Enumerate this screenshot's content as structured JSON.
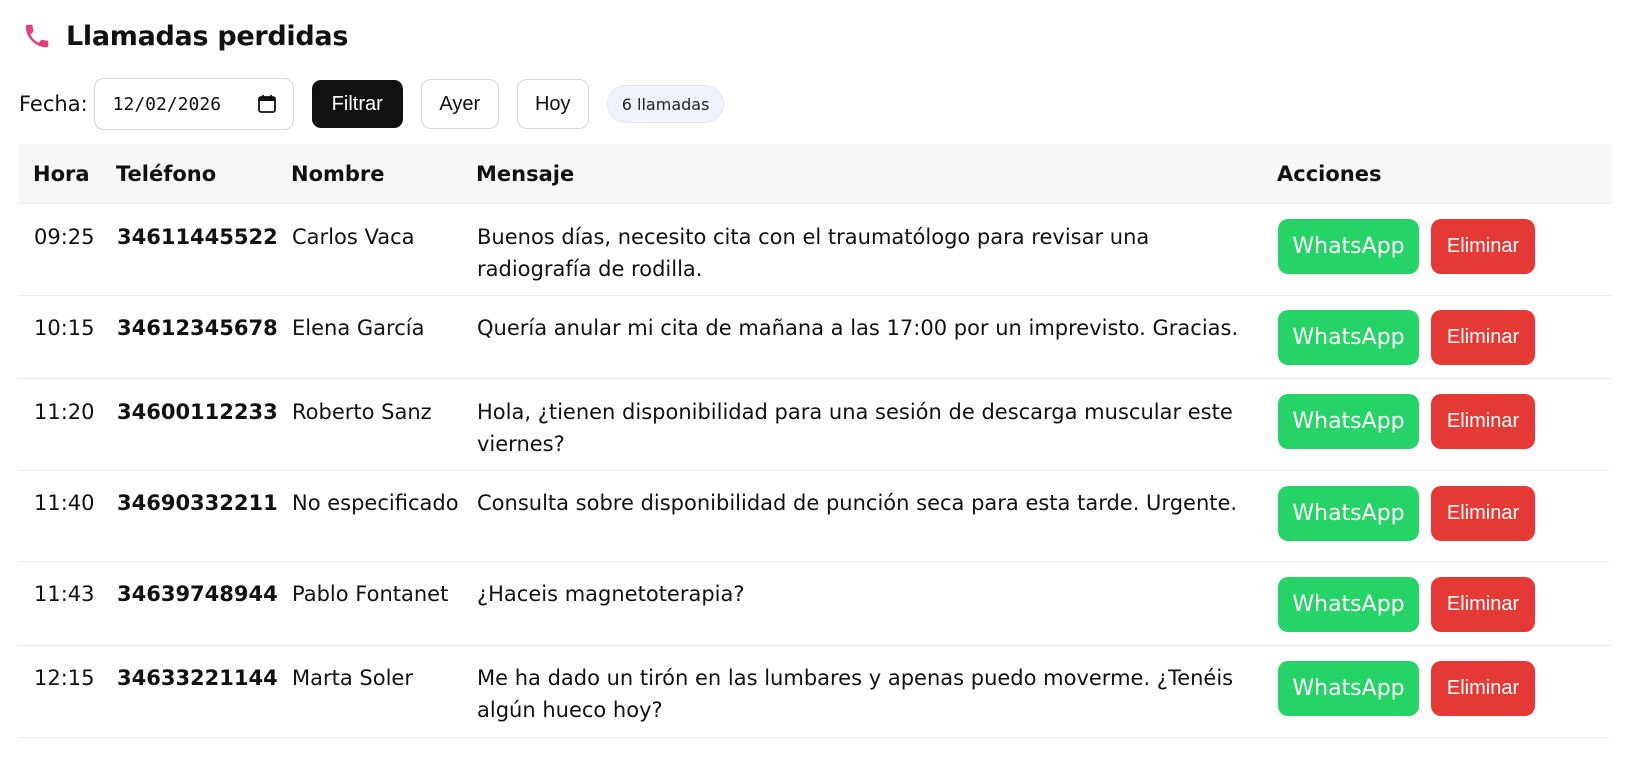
{
  "header": {
    "title": "Llamadas perdidas",
    "icon": "phone-icon",
    "icon_color": "#e0407a"
  },
  "toolbar": {
    "fecha_label": "Fecha:",
    "date_value": "12/02/2026",
    "filter_label": "Filtrar",
    "yesterday_label": "Ayer",
    "today_label": "Hoy",
    "count_badge": "6 llamadas"
  },
  "table": {
    "headers": {
      "hora": "Hora",
      "telefono": "Teléfono",
      "nombre": "Nombre",
      "mensaje": "Mensaje",
      "acciones": "Acciones"
    },
    "rows": [
      {
        "hora": "09:25",
        "telefono": "34611445522",
        "nombre": "Carlos Vaca",
        "mensaje": "Buenos días, necesito cita con el traumatólogo para revisar una radiografía de rodilla."
      },
      {
        "hora": "10:15",
        "telefono": "34612345678",
        "nombre": "Elena García",
        "mensaje": "Quería anular mi cita de mañana a las 17:00 por un imprevisto. Gracias."
      },
      {
        "hora": "11:20",
        "telefono": "34600112233",
        "nombre": "Roberto Sanz",
        "mensaje": "Hola, ¿tienen disponibilidad para una sesión de descarga muscular este viernes?"
      },
      {
        "hora": "11:40",
        "telefono": "34690332211",
        "nombre": "No especificado",
        "mensaje": "Consulta sobre disponibilidad de punción seca para esta tarde. Urgente."
      },
      {
        "hora": "11:43",
        "telefono": "34639748944",
        "nombre": "Pablo Fontanet",
        "mensaje": "¿Haceis magnetoterapia?"
      },
      {
        "hora": "12:15",
        "telefono": "34633221144",
        "nombre": "Marta Soler",
        "mensaje": "Me ha dado un tirón en las lumbares y apenas puedo moverme. ¿Tenéis algún hueco hoy?"
      }
    ],
    "whatsapp_label": "WhatsApp",
    "delete_label": "Eliminar"
  },
  "colors": {
    "whatsapp": "#25d366",
    "delete": "#e53935",
    "filter": "#111111",
    "badge_bg": "#eef2fa"
  }
}
